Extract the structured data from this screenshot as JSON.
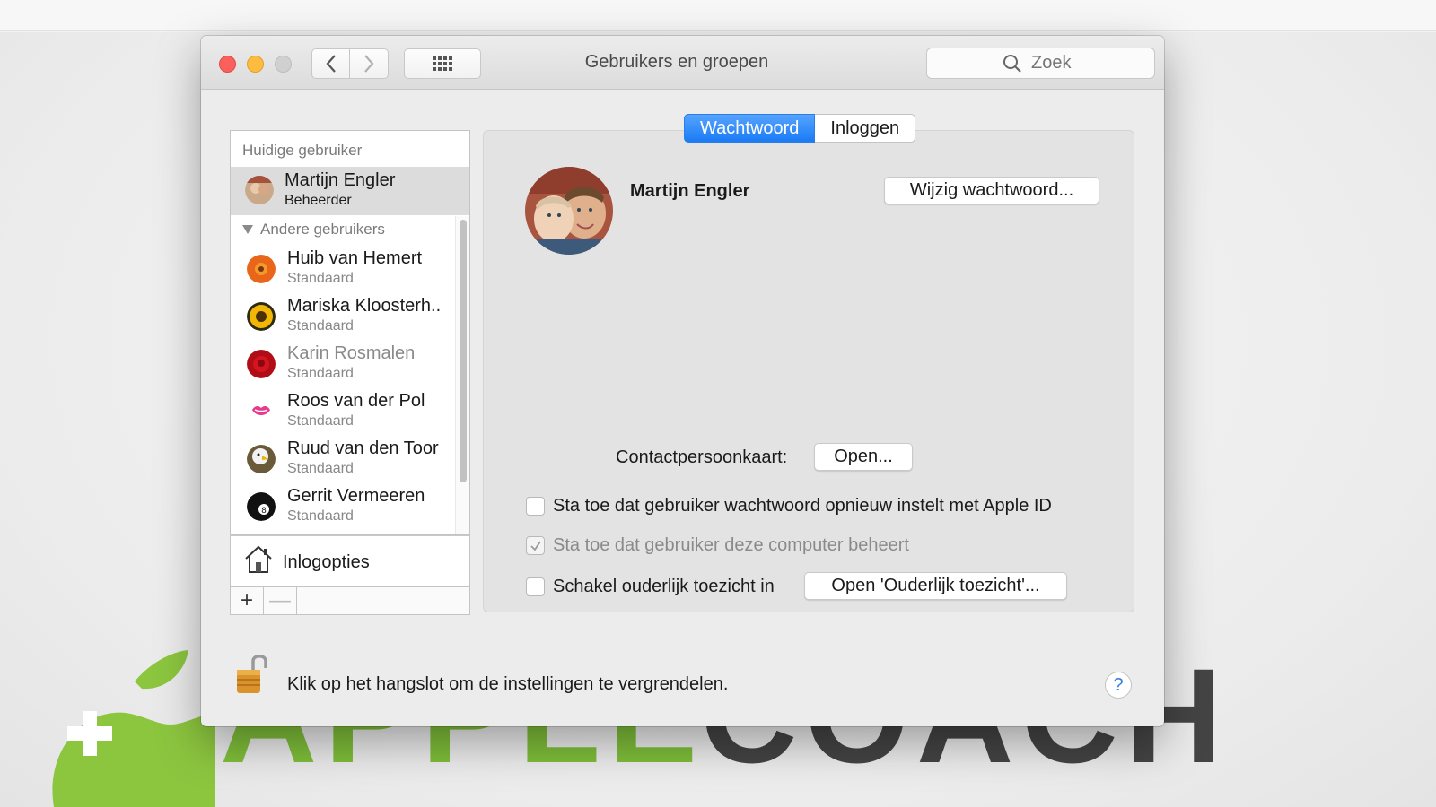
{
  "window": {
    "title": "Gebruikers en groepen",
    "search_placeholder": "Zoek"
  },
  "sidebar": {
    "current_header": "Huidige gebruiker",
    "current_user": {
      "name": "Martijn Engler",
      "role": "Beheerder"
    },
    "other_header": "Andere gebruikers",
    "others": [
      {
        "name": "Huib van Hemert",
        "role": "Standaard"
      },
      {
        "name": "Mariska Kloosterh..",
        "role": "Standaard"
      },
      {
        "name": "Karin Rosmalen",
        "role": "Standaard"
      },
      {
        "name": "Roos van der Pol",
        "role": "Standaard"
      },
      {
        "name": "Ruud van den Toor",
        "role": "Standaard"
      },
      {
        "name": "Gerrit Vermeeren",
        "role": "Standaard"
      }
    ],
    "login_options_label": "Inlogopties",
    "add_label": "+",
    "remove_label": "—"
  },
  "tabs": [
    {
      "label": "Wachtwoord",
      "active": true
    },
    {
      "label": "Inloggen",
      "active": false
    }
  ],
  "main": {
    "user_name": "Martijn Engler",
    "change_password_button": "Wijzig wachtwoord...",
    "contact_label": "Contactpersoonkaart:",
    "open_button": "Open...",
    "option_reset_appleid": "Sta toe dat gebruiker wachtwoord opnieuw instelt met Apple ID",
    "option_admin": "Sta toe dat gebruiker deze computer beheert",
    "option_admin_checked": true,
    "option_parental": "Schakel ouderlijk toezicht in",
    "parental_button": "Open 'Ouderlijk toezicht'..."
  },
  "footer": {
    "lock_text": "Klik op het hangslot om de instellingen te vergrendelen.",
    "help_label": "?"
  },
  "colors": {
    "accent": "#1a7bf5",
    "close": "#fc605c",
    "minimize": "#fdbc40"
  }
}
